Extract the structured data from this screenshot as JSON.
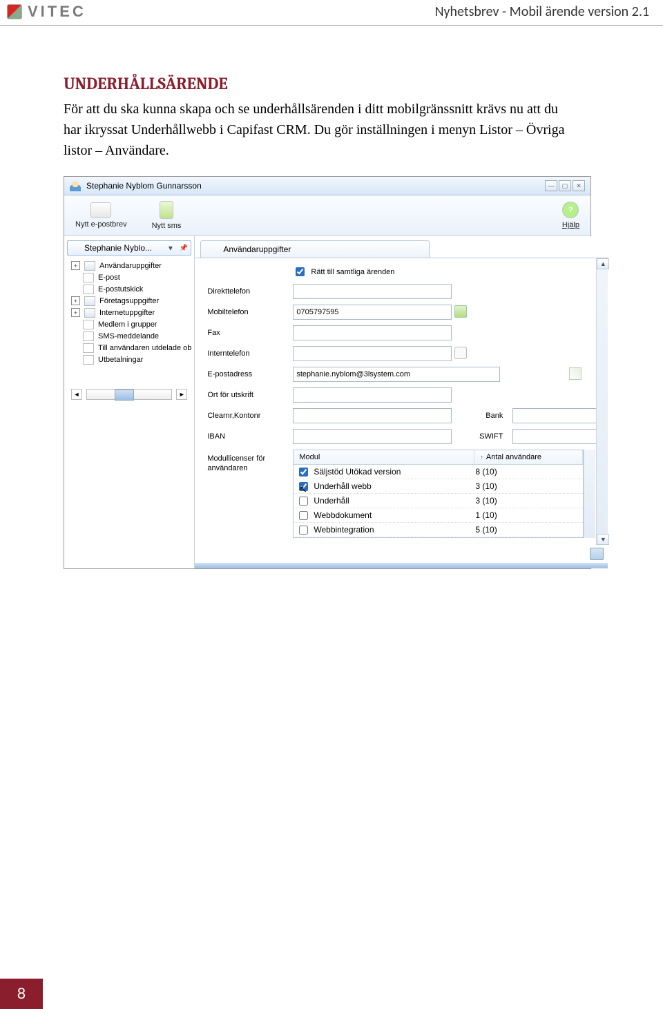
{
  "header": {
    "brand": "VITEC",
    "doc_title": "Nyhetsbrev - Mobil ärende version 2.1"
  },
  "section": {
    "heading": "UNDERHÅLLSÄRENDE",
    "paragraph": "För att du ska kunna skapa och se underhållsärenden i ditt mobilgränssnitt krävs nu att du har ikryssat Underhållwebb i Capifast CRM. Du gör inställningen i menyn Listor – Övriga listor – Användare."
  },
  "screenshot": {
    "window_title": "Stephanie Nyblom Gunnarsson",
    "toolbar": {
      "new_mail": "Nytt e-postbrev",
      "new_sms": "Nytt sms",
      "help": "Hjälp",
      "help_glyph": "?"
    },
    "tree": {
      "user_short": "Stephanie Nyblo...",
      "caret": "▾",
      "pin": "📌",
      "items": [
        {
          "exp": "+",
          "label": "Användaruppgifter"
        },
        {
          "exp": "",
          "label": "E-post"
        },
        {
          "exp": "",
          "label": "E-postutskick"
        },
        {
          "exp": "+",
          "label": "Företagsuppgifter"
        },
        {
          "exp": "+",
          "label": "Internetuppgifter"
        },
        {
          "exp": "",
          "label": "Medlem i grupper"
        },
        {
          "exp": "",
          "label": "SMS-meddelande"
        },
        {
          "exp": "",
          "label": "Till användaren utdelade ob"
        },
        {
          "exp": "",
          "label": "Utbetalningar"
        }
      ],
      "scroll_thumb_label": "III",
      "arr_left": "◄",
      "arr_right": "►"
    },
    "tab_label": "Användaruppgifter",
    "form": {
      "all_cases_checkbox": "Rätt till samtliga ärenden",
      "labels": {
        "direkt": "Direkttelefon",
        "mobil": "Mobiltelefon",
        "fax": "Fax",
        "intern": "Interntelefon",
        "email": "E-postadress",
        "ort": "Ort för utskrift",
        "clearnr": "Clearnr,Kontonr",
        "bank": "Bank",
        "iban": "IBAN",
        "swift": "SWIFT",
        "mods": "Modullicenser för användaren"
      },
      "values": {
        "direkt": "",
        "mobil": "0705797595",
        "fax": "",
        "intern": "",
        "email": "stephanie.nyblom@3lsystem.com",
        "ort": "",
        "clearnr": "",
        "bank": "",
        "iban": "",
        "swift": ""
      },
      "scroll_up": "▲",
      "scroll_dn": "▼"
    },
    "modules": {
      "head_col1": "Modul",
      "head_col2": "Antal användare",
      "sort_glyph": "↑",
      "rows": [
        {
          "checked": true,
          "name": "Säljstöd Utökad version",
          "count": "8 (10)"
        },
        {
          "checked": true,
          "name": "Underhåll webb",
          "count": "3 (10)",
          "cursor": true
        },
        {
          "checked": false,
          "name": "Underhåll",
          "count": "3 (10)"
        },
        {
          "checked": false,
          "name": "Webbdokument",
          "count": "1 (10)"
        },
        {
          "checked": false,
          "name": "Webbintegration",
          "count": "5 (10)"
        }
      ]
    },
    "winbtns": {
      "min": "—",
      "max": "▢",
      "close": "✕"
    }
  },
  "page_number": "8"
}
